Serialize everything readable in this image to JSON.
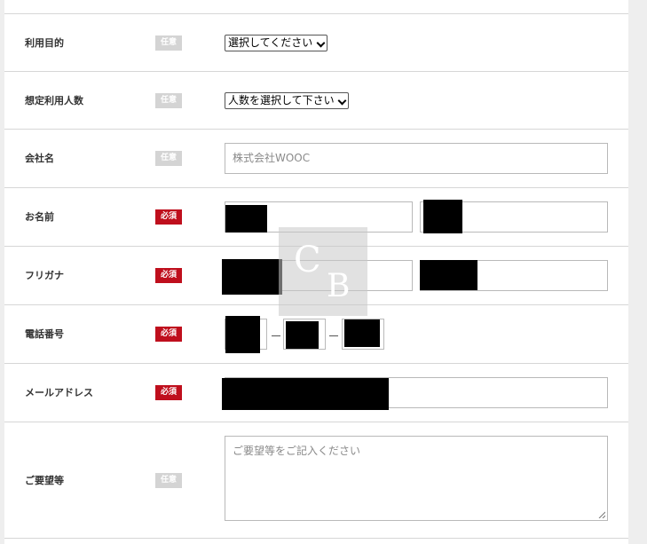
{
  "fields": {
    "purpose": {
      "label": "利用目的",
      "badge": "任意",
      "select_value": "選択してください"
    },
    "users": {
      "label": "想定利用人数",
      "badge": "任意",
      "select_value": "人数を選択して下さい"
    },
    "company": {
      "label": "会社名",
      "badge": "任意",
      "placeholder": "株式会社WOOC"
    },
    "name": {
      "label": "お名前",
      "badge": "必須"
    },
    "furigana": {
      "label": "フリガナ",
      "badge": "必須"
    },
    "phone": {
      "label": "電話番号",
      "badge": "必須"
    },
    "email": {
      "label": "メールアドレス",
      "badge": "必須"
    },
    "request": {
      "label": "ご要望等",
      "badge": "任意",
      "placeholder": "ご要望等をご記入ください"
    }
  },
  "watermark": {
    "letter1": "C",
    "letter2": "B"
  },
  "colors": {
    "required_badge": "#bf0f1d",
    "optional_badge": "#d4d4d4"
  },
  "icons": {
    "select_arrow": "chevron-down-icon",
    "textarea_grip": "resize-grip-icon"
  }
}
